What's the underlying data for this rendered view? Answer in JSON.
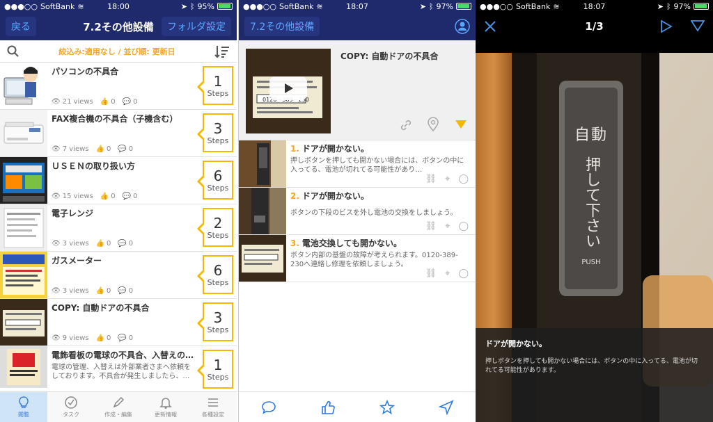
{
  "screen1": {
    "status": {
      "carrier": "SoftBank",
      "time": "18:00",
      "battery": "95%",
      "battery_level": 0.95
    },
    "nav": {
      "back": "戻る",
      "title": "7.2その他設備",
      "folder": "フォルダ設定"
    },
    "filter": {
      "text": "絞込み:適用なし / 並び順: 更新日"
    },
    "rows": [
      {
        "title": "パソコンの不具合",
        "desc": "",
        "views": "21 views",
        "likes": "0",
        "comments": "0",
        "steps": "1",
        "steps_label": "Steps"
      },
      {
        "title": "FAX複合機の不具合（子機含む）",
        "desc": "",
        "views": "7 views",
        "likes": "0",
        "comments": "0",
        "steps": "3",
        "steps_label": "Steps"
      },
      {
        "title": "ＵＳＥＮの取り扱い方",
        "desc": "",
        "views": "15 views",
        "likes": "0",
        "comments": "0",
        "steps": "6",
        "steps_label": "Steps"
      },
      {
        "title": "電子レンジ",
        "desc": "",
        "views": "3 views",
        "likes": "0",
        "comments": "0",
        "steps": "2",
        "steps_label": "Steps"
      },
      {
        "title": "ガスメーター",
        "desc": "",
        "views": "3 views",
        "likes": "0",
        "comments": "0",
        "steps": "6",
        "steps_label": "Steps"
      },
      {
        "title": "COPY: 自動ドアの不具合",
        "desc": "",
        "views": "9 views",
        "likes": "0",
        "comments": "0",
        "steps": "3",
        "steps_label": "Steps"
      },
      {
        "title": "電飾看板の電球の不具合、入替えの…",
        "desc": "電球の管理、入替えは外部業者さまへ依頼をしております。不具合が発生しましたら、…",
        "views": "",
        "likes": "0",
        "comments": "0",
        "steps": "1",
        "steps_label": "Steps"
      }
    ],
    "tabs": [
      {
        "label": "閲覧",
        "icon": "lightbulb-icon"
      },
      {
        "label": "タスク",
        "icon": "check-circle-icon"
      },
      {
        "label": "作成・編集",
        "icon": "pencil-icon"
      },
      {
        "label": "更新情報",
        "icon": "bell-icon"
      },
      {
        "label": "各種設定",
        "icon": "menu-icon"
      }
    ]
  },
  "screen2": {
    "status": {
      "carrier": "SoftBank",
      "time": "18:07",
      "battery": "97%",
      "battery_level": 0.97
    },
    "nav": {
      "back": "7.2その他設備"
    },
    "header": {
      "title": "COPY: 自動ドアの不具合",
      "thumb_text": "0120－389－230"
    },
    "steps": [
      {
        "num": "1.",
        "title": "ドアが開かない。",
        "desc": "押しボタンを押しても開かない場合には、ボタンの中に入ってる、電池が切れてる可能性があり…"
      },
      {
        "num": "2.",
        "title": "ドアが開かない。",
        "desc": "ボタンの下段のビスを外し電池の交換をしましょう。"
      },
      {
        "num": "3.",
        "title": "電池交換しても開かない。",
        "desc": "ボタン内部の基盤の故障が考えられます。0120-389-230へ連絡し修理を依頼しましょう。"
      }
    ]
  },
  "screen3": {
    "status": {
      "carrier": "SoftBank",
      "time": "18:07",
      "battery": "97%",
      "battery_level": 0.97
    },
    "counter": "1/3",
    "photo": {
      "text1": "自動",
      "text2": "押して下さい",
      "text3": "PUSH"
    },
    "caption": {
      "title": "ドアが開かない。",
      "desc": "押しボタンを押しても開かない場合には、ボタンの中に入ってる、電池が切れてる可能性があります。"
    }
  }
}
